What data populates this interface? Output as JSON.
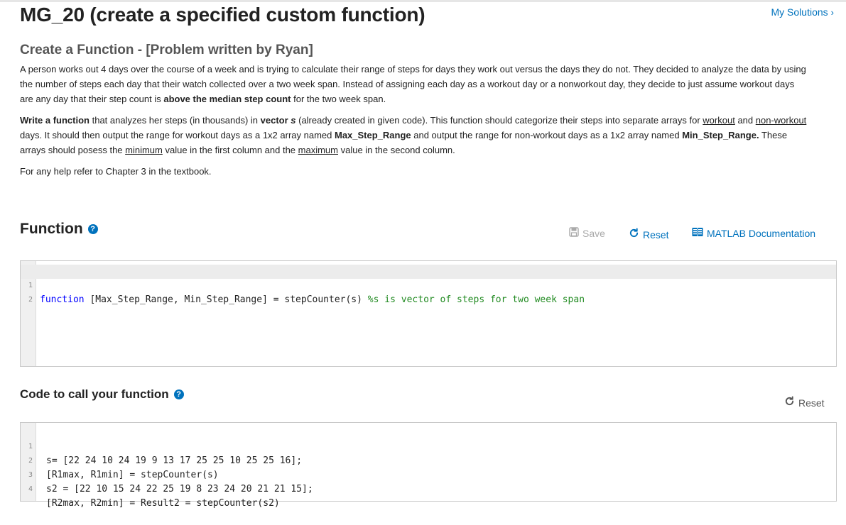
{
  "header": {
    "title": "MG_20 (create a specified custom function)",
    "my_solutions": "My Solutions",
    "chevron": "›"
  },
  "problem": {
    "title": "Create a Function - [Problem written by Ryan]",
    "p1": {
      "t1": "A person works out 4 days over the course of a week and is trying to calculate their range of steps for days they work out versus the days they do not. They decided to analyze the data by using the number of steps each day that their watch collected over a two week span. Instead of assigning each day as a workout day or a nonworkout day, they decide to just assume workout days are any day that their step count is ",
      "b1": "above the median step count",
      "t2": " for the two week span."
    },
    "p2": {
      "b1": "Write a function",
      "t1": " that analyzes her steps (in thousands) in ",
      "b2": "vector ",
      "b3": "s",
      "t2": " (already created in given code). This function should categorize their steps into separate arrays for ",
      "u1": "workout",
      "t3": " and ",
      "u2": "non-workout",
      "t4": " days. It should then output the range for workout days as a 1x2 array named ",
      "b4": "Max_Step_Range",
      "t5": " and output the range for non-workout days as a 1x2 array named ",
      "b5": "Min_Step_Range.",
      "t6": " These arrays should posess the ",
      "u3": "minimum",
      "t7": " value in the first column and the ",
      "u4": "maximum",
      "t8": " value in the second column."
    },
    "p3": "For any help refer to Chapter 3 in the textbook."
  },
  "function_section": {
    "heading": "Function",
    "help": "?",
    "save": "Save",
    "reset": "Reset",
    "docs": "MATLAB Documentation",
    "lines": [
      {
        "num": "1",
        "keyword": "function",
        "code": " [Max_Step_Range, Min_Step_Range] = stepCounter(s) ",
        "comment": "%s is vector of steps for two week span"
      },
      {
        "num": "2",
        "keyword": "",
        "code": "",
        "comment": ""
      }
    ]
  },
  "call_section": {
    "heading": "Code to call your function",
    "help": "?",
    "reset": "Reset",
    "lines": [
      {
        "num": "1",
        "code": "s= [22 24 10 24 19 9 13 17 25 25 10 25 25 16];"
      },
      {
        "num": "2",
        "code": "[R1max, R1min] = stepCounter(s)"
      },
      {
        "num": "3",
        "code": "s2 = [22 10 15 24 22 25 19 8 23 24 20 21 21 15];"
      },
      {
        "num": "4",
        "code": "[R2max, R2min] = Result2 = stepCounter(s2)"
      }
    ]
  },
  "icons": {
    "save": "floppy-disk-icon",
    "reset": "refresh-icon",
    "docs": "book-icon",
    "help": "question-circle-icon"
  },
  "colors": {
    "link": "#0072bd",
    "keyword": "#0000ff",
    "comment": "#228b22",
    "disabled": "#a9a9a9"
  }
}
